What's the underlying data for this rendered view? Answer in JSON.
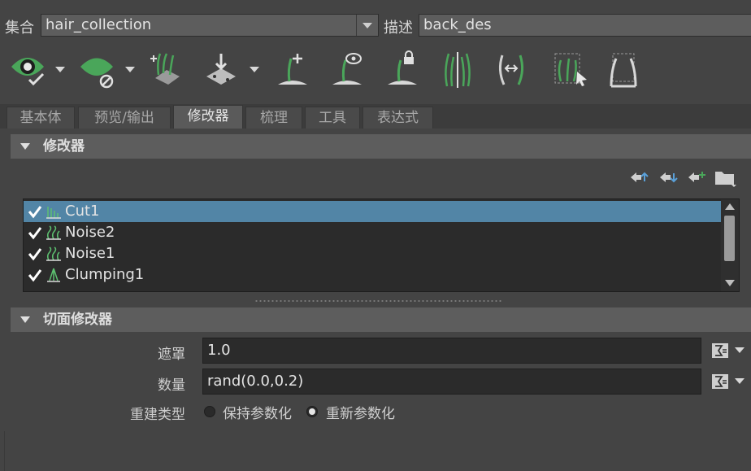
{
  "collection": {
    "label": "集合",
    "value": "hair_collection"
  },
  "description": {
    "label": "描述",
    "value": "back_des"
  },
  "toolbar": {
    "icons": [
      "preview-eye-icon",
      "hide-leaf-icon",
      "groom-add-icon",
      "place-guides-icon",
      "add-guide-icon",
      "guide-visibility-icon",
      "lock-guide-icon",
      "split-guide-icon",
      "flip-guide-icon",
      "select-guides-icon",
      "guide-bounds-icon"
    ]
  },
  "tabs": [
    "基本体",
    "预览/输出",
    "修改器",
    "梳理",
    "工具",
    "表达式"
  ],
  "active_tab": 2,
  "modifiers_section": {
    "title": "修改器"
  },
  "modifiers": [
    {
      "name": "Cut1",
      "enabled": true,
      "selected": true,
      "icon": "cut-icon"
    },
    {
      "name": "Noise2",
      "enabled": true,
      "selected": false,
      "icon": "noise-icon"
    },
    {
      "name": "Noise1",
      "enabled": true,
      "selected": false,
      "icon": "noise-icon"
    },
    {
      "name": "Clumping1",
      "enabled": true,
      "selected": false,
      "icon": "clumping-icon"
    }
  ],
  "cut_section": {
    "title": "切面修改器"
  },
  "props": {
    "mask": {
      "label": "遮罩",
      "value": "1.0"
    },
    "amount": {
      "label": "数量",
      "value": "rand(0.0,0.2)"
    },
    "rebuild": {
      "label": "重建类型",
      "options": [
        "保持参数化",
        "重新参数化"
      ],
      "selected": 1
    }
  },
  "colors": {
    "accent_green": "#4aa65a",
    "selection": "#5285a6"
  }
}
